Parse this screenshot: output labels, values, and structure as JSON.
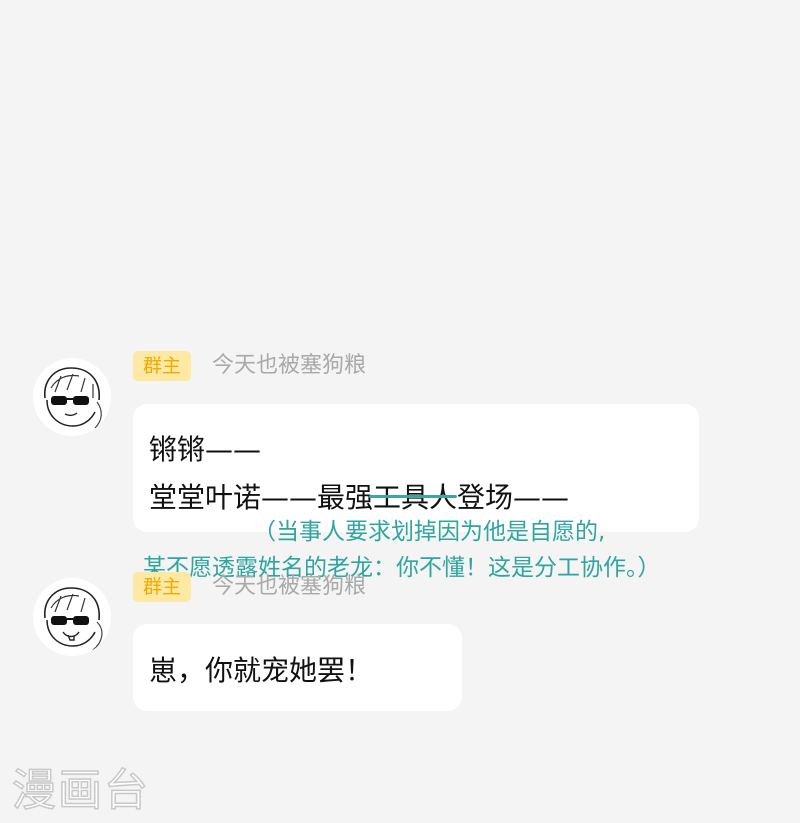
{
  "messages": [
    {
      "avatar_icon": "sunglasses-character-avatar-icon",
      "role_tag": "群主",
      "sender": "今天也被塞狗粮",
      "line1": "锵锵——",
      "line2_a": "堂堂叶诺——最强",
      "line2_struck": "工具人",
      "line2_b": "登场——"
    },
    {
      "avatar_icon": "sunglasses-character-avatar-icon",
      "role_tag": "群主",
      "sender": "今天也被塞狗粮",
      "text": "崽，你就宠她罢！"
    }
  ],
  "annotation": {
    "line1": "（当事人要求划掉因为他是自愿的,",
    "line2": "某不愿透露姓名的老龙：你不懂！这是分工协作。）"
  },
  "watermark": "漫画台",
  "colors": {
    "background": "#f4f4f4",
    "role_tag_bg": "#fde9a3",
    "role_tag_text": "#f2a900",
    "annotation": "#2ea59f",
    "strike": "#3aa7a3"
  }
}
